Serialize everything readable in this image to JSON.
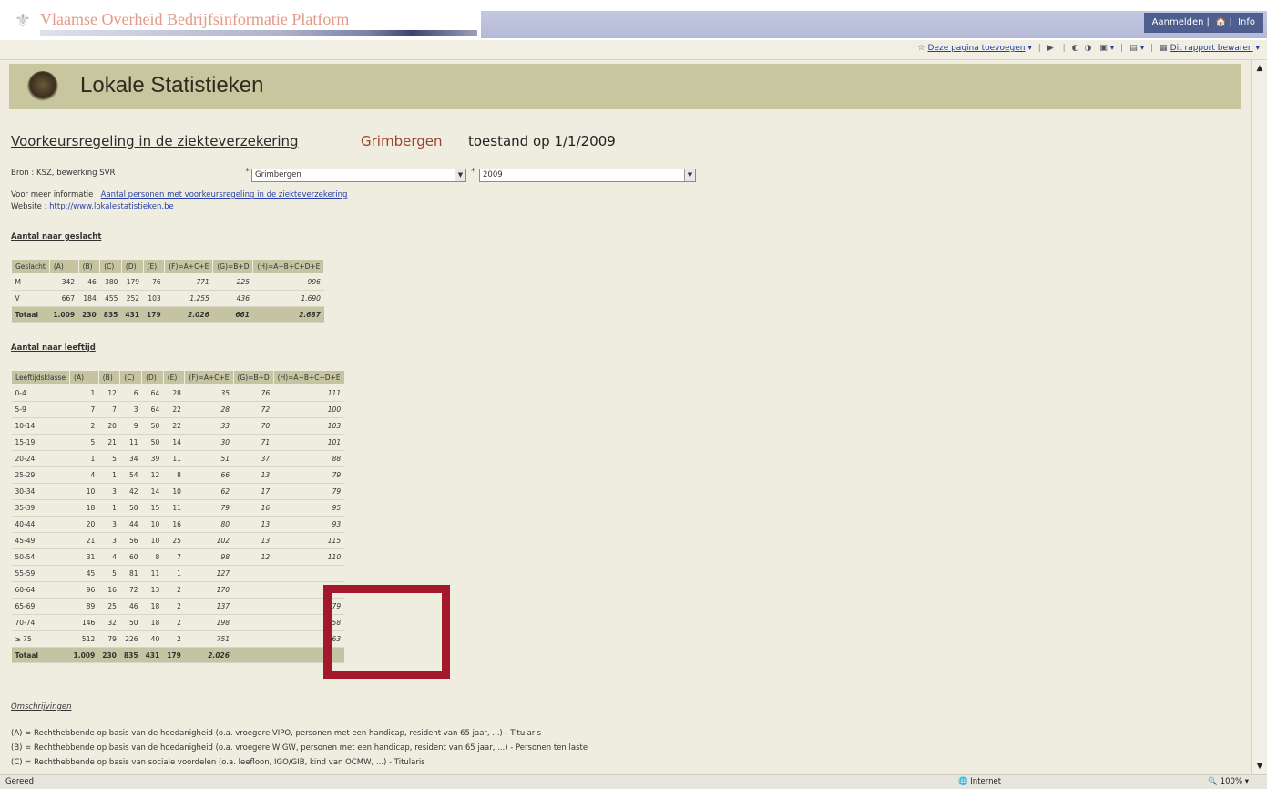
{
  "banner": {
    "title": "Vlaamse Overheid Bedrijfsinformatie Platform",
    "links": [
      "Aanmelden",
      "🏠",
      "Info"
    ]
  },
  "commandbar": {
    "items": [
      "Deze pagina toevoegen",
      "Dit rapport bewaren"
    ]
  },
  "header": {
    "title": "Lokale Statistieken"
  },
  "subtitle": {
    "main": "Voorkeursregeling in de ziekteverzekering",
    "place": "Grimbergen",
    "date": "toestand op 1/1/2009"
  },
  "info": {
    "bron": "Bron : KSZ, bewerking SVR",
    "meer_label": "Voor meer informatie :",
    "meer_link": "Aantal personen met voorkeursregeling in de ziekteverzekering",
    "website_label": "Website :",
    "website_link": "http://www.lokalestatistieken.be"
  },
  "selects": {
    "gemeente": "Grimbergen",
    "jaar": "2009"
  },
  "section1": {
    "title": "Aantal naar geslacht",
    "headers": [
      "Geslacht",
      "(A)",
      "(B)",
      "(C)",
      "(D)",
      "(E)",
      "(F)=A+C+E",
      "(G)=B+D",
      "(H)=A+B+C+D+E"
    ],
    "rows": [
      [
        "M",
        "342",
        "46",
        "380",
        "179",
        "76",
        "771",
        "225",
        "996"
      ],
      [
        "V",
        "667",
        "184",
        "455",
        "252",
        "103",
        "1.255",
        "436",
        "1.690"
      ]
    ],
    "total": [
      "Totaal",
      "1.009",
      "230",
      "835",
      "431",
      "179",
      "2.026",
      "661",
      "2.687"
    ]
  },
  "section2": {
    "title": "Aantal naar leeftijd",
    "headers": [
      "Leeftijdsklasse",
      "(A)",
      "(B)",
      "(C)",
      "(D)",
      "(E)",
      "(F)=A+C+E",
      "(G)=B+D",
      "(H)=A+B+C+D+E"
    ],
    "rows": [
      [
        "0-4",
        "1",
        "12",
        "6",
        "64",
        "28",
        "35",
        "76",
        "111"
      ],
      [
        "5-9",
        "7",
        "7",
        "3",
        "64",
        "22",
        "28",
        "72",
        "100"
      ],
      [
        "10-14",
        "2",
        "20",
        "9",
        "50",
        "22",
        "33",
        "70",
        "103"
      ],
      [
        "15-19",
        "5",
        "21",
        "11",
        "50",
        "14",
        "30",
        "71",
        "101"
      ],
      [
        "20-24",
        "1",
        "5",
        "34",
        "39",
        "11",
        "51",
        "37",
        "88"
      ],
      [
        "25-29",
        "4",
        "1",
        "54",
        "12",
        "8",
        "66",
        "13",
        "79"
      ],
      [
        "30-34",
        "10",
        "3",
        "42",
        "14",
        "10",
        "62",
        "17",
        "79"
      ],
      [
        "35-39",
        "18",
        "1",
        "50",
        "15",
        "11",
        "79",
        "16",
        "95"
      ],
      [
        "40-44",
        "20",
        "3",
        "44",
        "10",
        "16",
        "80",
        "13",
        "93"
      ],
      [
        "45-49",
        "21",
        "3",
        "56",
        "10",
        "25",
        "102",
        "13",
        "115"
      ],
      [
        "50-54",
        "31",
        "4",
        "60",
        "8",
        "7",
        "98",
        "12",
        "110"
      ],
      [
        "55-59",
        "45",
        "5",
        "81",
        "11",
        "1",
        "127",
        "",
        ""
      ],
      [
        "60-64",
        "96",
        "16",
        "72",
        "13",
        "2",
        "170",
        "",
        "199"
      ],
      [
        "65-69",
        "89",
        "25",
        "46",
        "18",
        "2",
        "137",
        "",
        "179"
      ],
      [
        "70-74",
        "146",
        "32",
        "50",
        "18",
        "2",
        "198",
        "",
        "258"
      ],
      [
        "≥ 75",
        "512",
        "79",
        "226",
        "40",
        "2",
        "751",
        "",
        "863"
      ]
    ],
    "total": [
      "Totaal",
      "1.009",
      "230",
      "835",
      "431",
      "179",
      "2.026",
      "",
      ""
    ]
  },
  "legend": {
    "title": "Omschrijvingen",
    "lines": [
      "(A) = Rechthebbende op basis van de hoedanigheid (o.a. vroegere VIPO, personen met een handicap, resident van 65 jaar, ...) - Titularis",
      "(B) = Rechthebbende op basis van de hoedanigheid (o.a. vroegere WIGW, personen met een handicap, resident van 65 jaar, ...) - Personen ten laste",
      "(C) = Rechthebbende op basis van sociale voordelen (o.a. leefloon, IGO/GIB, kind van OCMW, ...) - Titularis"
    ]
  },
  "statusbar": {
    "left": "Gereed",
    "zone": "Internet",
    "zoom": "100%"
  },
  "colors": {
    "page_bg": "#eeede0",
    "header_band": "#c7c69e",
    "highlight": "#a3182a"
  }
}
